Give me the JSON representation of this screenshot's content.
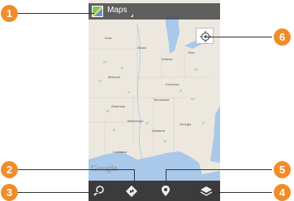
{
  "app": {
    "title": "Maps"
  },
  "map": {
    "labels": {
      "iowa": "Iowa",
      "illinois": "Illinois",
      "indiana": "Indiana",
      "ohio": "Ohio",
      "missouri": "Missouri",
      "kentucky": "Kentucky",
      "tennessee": "Tennessee",
      "arkansas": "Arkansas",
      "mississippi": "Mississippi",
      "alabama": "Alabama",
      "georgia": "Georgia",
      "louisiana": "Louisiana"
    },
    "attribution": "Google"
  },
  "toolbar": {
    "search": "search-icon",
    "directions": "directions-icon",
    "places": "places-icon",
    "layers": "layers-icon"
  },
  "callouts": [
    "1",
    "2",
    "3",
    "4",
    "5",
    "6"
  ],
  "colors": {
    "callout": "#f28c28",
    "toolbar": "#3b3b3b",
    "water": "#a9c8ea",
    "land": "#ece8df"
  }
}
